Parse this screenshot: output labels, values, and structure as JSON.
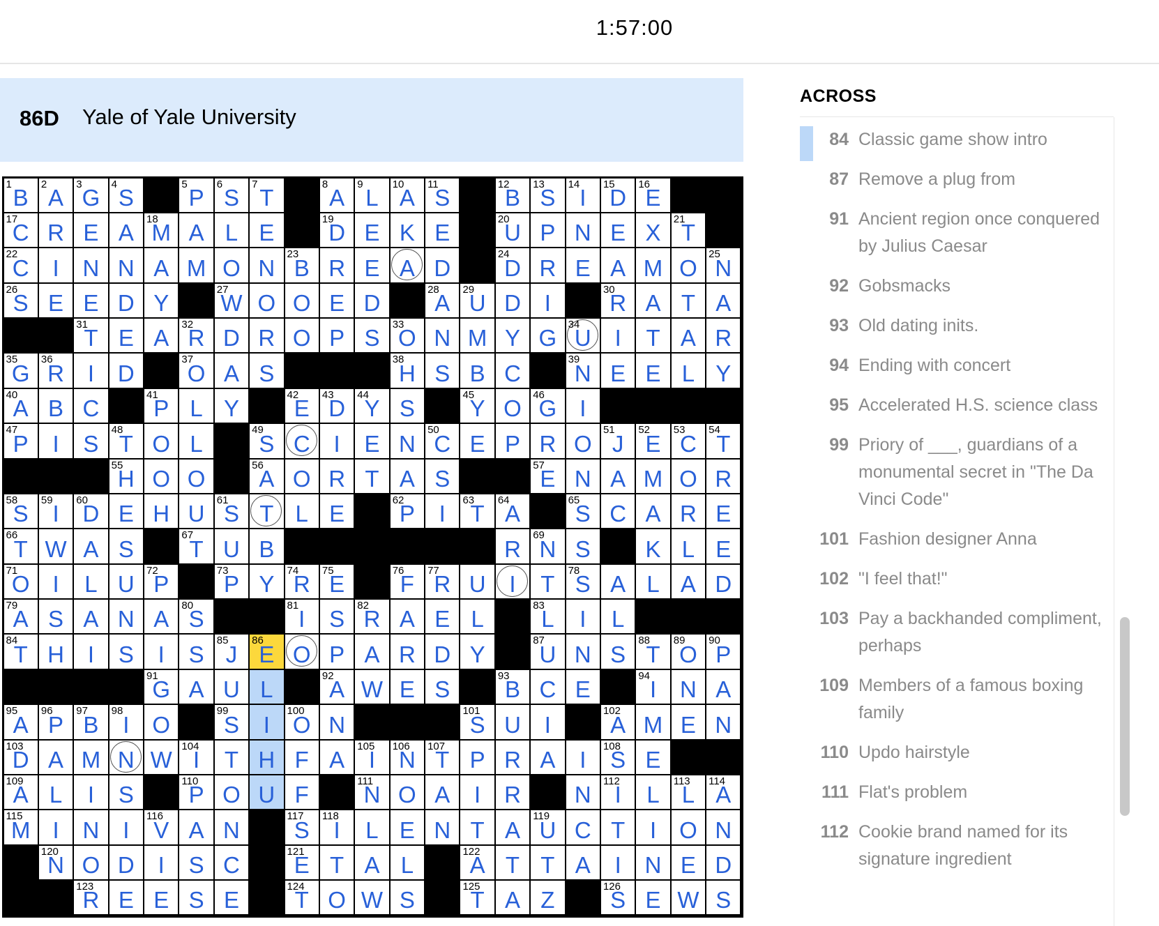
{
  "timer": "1:57:00",
  "current_clue": {
    "number": "86D",
    "text": "Yale of Yale University"
  },
  "across_heading": "ACROSS",
  "across_clues": [
    {
      "num": "84",
      "text": "Classic game show intro",
      "highlighted": true
    },
    {
      "num": "87",
      "text": "Remove a plug from"
    },
    {
      "num": "91",
      "text": "Ancient region once conquered by Julius Caesar"
    },
    {
      "num": "92",
      "text": "Gobsmacks"
    },
    {
      "num": "93",
      "text": "Old dating inits."
    },
    {
      "num": "94",
      "text": "Ending with concert"
    },
    {
      "num": "95",
      "text": "Accelerated H.S. science class"
    },
    {
      "num": "99",
      "text": "Priory of ___, guardians of a monumental secret in \"The Da Vinci Code\""
    },
    {
      "num": "101",
      "text": "Fashion designer Anna"
    },
    {
      "num": "102",
      "text": "\"I feel that!\""
    },
    {
      "num": "103",
      "text": "Pay a backhanded compliment, perhaps"
    },
    {
      "num": "109",
      "text": "Members of a famous boxing family"
    },
    {
      "num": "110",
      "text": "Updo hairstyle"
    },
    {
      "num": "111",
      "text": "Flat's problem"
    },
    {
      "num": "112",
      "text": "Cookie brand named for its signature ingredient"
    }
  ],
  "grid": {
    "size": 21,
    "rows": [
      "BAGS#PST#ALAS#BSIDE##",
      "CREAMALE#DEKE#UPNEXT#",
      "CINNAMONBREAD#DREAMON",
      "SEEDY#WOOED#AUDI#RATA",
      "##TEARDROPSONMYGUITAR",
      "GRID#OAS###HSBC#NEELY",
      "ABC#PLY#EDYS#YOGI####",
      "PISTOL#SCIENCEPROJECT",
      "###HOO#AORTAS##ENAMOR",
      "SIDEHUSTLE#PITA#SCARE",
      "TWAS#TUB######RNS#KLEE",
      "OILUP#PYRE#FRUITSALAD",
      "ASANAS##ISRAEL#LIL###",
      "THISISJEOPARDY#UNSTOP",
      "####GAUL#AWES#BCE#INA",
      "APBIO#SION###SUI#AMEN",
      "DAMNWITHFAINTPRAISE##",
      "ALIS#POUF#NOAIR#NILLA",
      "MINIVAN#SILENTAUCTION",
      "#NODISC#ETAL#ATTAINED",
      "##REESE#TOWS#TAZ#SEWS"
    ],
    "numbers": [
      [
        0,
        0,
        1
      ],
      [
        0,
        1,
        2
      ],
      [
        0,
        2,
        3
      ],
      [
        0,
        3,
        4
      ],
      [
        0,
        5,
        5
      ],
      [
        0,
        6,
        6
      ],
      [
        0,
        7,
        7
      ],
      [
        0,
        9,
        8
      ],
      [
        0,
        10,
        9
      ],
      [
        0,
        11,
        10
      ],
      [
        0,
        12,
        11
      ],
      [
        0,
        14,
        12
      ],
      [
        0,
        15,
        13
      ],
      [
        0,
        16,
        14
      ],
      [
        0,
        17,
        15
      ],
      [
        0,
        18,
        16
      ],
      [
        1,
        0,
        17
      ],
      [
        1,
        4,
        18
      ],
      [
        1,
        9,
        19
      ],
      [
        1,
        14,
        20
      ],
      [
        1,
        19,
        21
      ],
      [
        2,
        0,
        22
      ],
      [
        2,
        8,
        23
      ],
      [
        2,
        14,
        24
      ],
      [
        2,
        20,
        25
      ],
      [
        3,
        0,
        26
      ],
      [
        3,
        6,
        27
      ],
      [
        3,
        12,
        28
      ],
      [
        3,
        13,
        29
      ],
      [
        3,
        17,
        30
      ],
      [
        4,
        2,
        31
      ],
      [
        4,
        5,
        32
      ],
      [
        4,
        11,
        33
      ],
      [
        4,
        16,
        34
      ],
      [
        5,
        0,
        35
      ],
      [
        5,
        1,
        36
      ],
      [
        5,
        5,
        37
      ],
      [
        5,
        11,
        38
      ],
      [
        5,
        16,
        39
      ],
      [
        6,
        0,
        40
      ],
      [
        6,
        4,
        41
      ],
      [
        6,
        8,
        42
      ],
      [
        6,
        9,
        43
      ],
      [
        6,
        10,
        44
      ],
      [
        6,
        13,
        45
      ],
      [
        6,
        15,
        46
      ],
      [
        7,
        0,
        47
      ],
      [
        7,
        3,
        48
      ],
      [
        7,
        7,
        49
      ],
      [
        7,
        12,
        50
      ],
      [
        7,
        17,
        51
      ],
      [
        7,
        18,
        52
      ],
      [
        7,
        19,
        53
      ],
      [
        7,
        20,
        54
      ],
      [
        8,
        3,
        55
      ],
      [
        8,
        7,
        56
      ],
      [
        8,
        15,
        57
      ],
      [
        9,
        0,
        58
      ],
      [
        9,
        1,
        59
      ],
      [
        9,
        2,
        60
      ],
      [
        9,
        6,
        61
      ],
      [
        9,
        11,
        62
      ],
      [
        9,
        13,
        63
      ],
      [
        9,
        14,
        64
      ],
      [
        9,
        16,
        65
      ],
      [
        10,
        0,
        66
      ],
      [
        10,
        5,
        67
      ],
      [
        10,
        13,
        68
      ],
      [
        10,
        15,
        69
      ],
      [
        10,
        17,
        70
      ],
      [
        11,
        0,
        71
      ],
      [
        11,
        4,
        72
      ],
      [
        11,
        6,
        73
      ],
      [
        11,
        8,
        74
      ],
      [
        11,
        9,
        75
      ],
      [
        11,
        11,
        76
      ],
      [
        11,
        12,
        77
      ],
      [
        11,
        16,
        78
      ],
      [
        12,
        0,
        79
      ],
      [
        12,
        5,
        80
      ],
      [
        12,
        8,
        81
      ],
      [
        12,
        10,
        82
      ],
      [
        12,
        15,
        83
      ],
      [
        13,
        0,
        84
      ],
      [
        13,
        6,
        85
      ],
      [
        13,
        7,
        86
      ],
      [
        13,
        15,
        87
      ],
      [
        13,
        18,
        88
      ],
      [
        13,
        19,
        89
      ],
      [
        13,
        20,
        90
      ],
      [
        14,
        4,
        91
      ],
      [
        14,
        9,
        92
      ],
      [
        14,
        14,
        93
      ],
      [
        14,
        18,
        94
      ],
      [
        15,
        0,
        95
      ],
      [
        15,
        1,
        96
      ],
      [
        15,
        2,
        97
      ],
      [
        15,
        3,
        98
      ],
      [
        15,
        6,
        99
      ],
      [
        15,
        8,
        100
      ],
      [
        15,
        13,
        101
      ],
      [
        15,
        17,
        102
      ],
      [
        16,
        0,
        103
      ],
      [
        16,
        5,
        104
      ],
      [
        16,
        10,
        105
      ],
      [
        16,
        11,
        106
      ],
      [
        16,
        12,
        107
      ],
      [
        16,
        17,
        108
      ],
      [
        17,
        0,
        109
      ],
      [
        17,
        5,
        110
      ],
      [
        17,
        10,
        111
      ],
      [
        17,
        17,
        112
      ],
      [
        17,
        19,
        113
      ],
      [
        17,
        20,
        114
      ],
      [
        18,
        0,
        115
      ],
      [
        18,
        4,
        116
      ],
      [
        18,
        8,
        117
      ],
      [
        18,
        9,
        118
      ],
      [
        18,
        15,
        119
      ],
      [
        19,
        1,
        120
      ],
      [
        19,
        8,
        121
      ],
      [
        19,
        13,
        122
      ],
      [
        20,
        2,
        123
      ],
      [
        20,
        8,
        124
      ],
      [
        20,
        13,
        125
      ],
      [
        20,
        17,
        126
      ]
    ],
    "circles": [
      [
        2,
        11
      ],
      [
        4,
        16
      ],
      [
        7,
        8
      ],
      [
        9,
        7
      ],
      [
        11,
        14
      ],
      [
        13,
        8
      ],
      [
        16,
        3
      ]
    ],
    "selected": [
      13,
      7
    ],
    "highlighted_word": [
      [
        14,
        7
      ],
      [
        15,
        7
      ],
      [
        16,
        7
      ],
      [
        17,
        7
      ]
    ]
  }
}
